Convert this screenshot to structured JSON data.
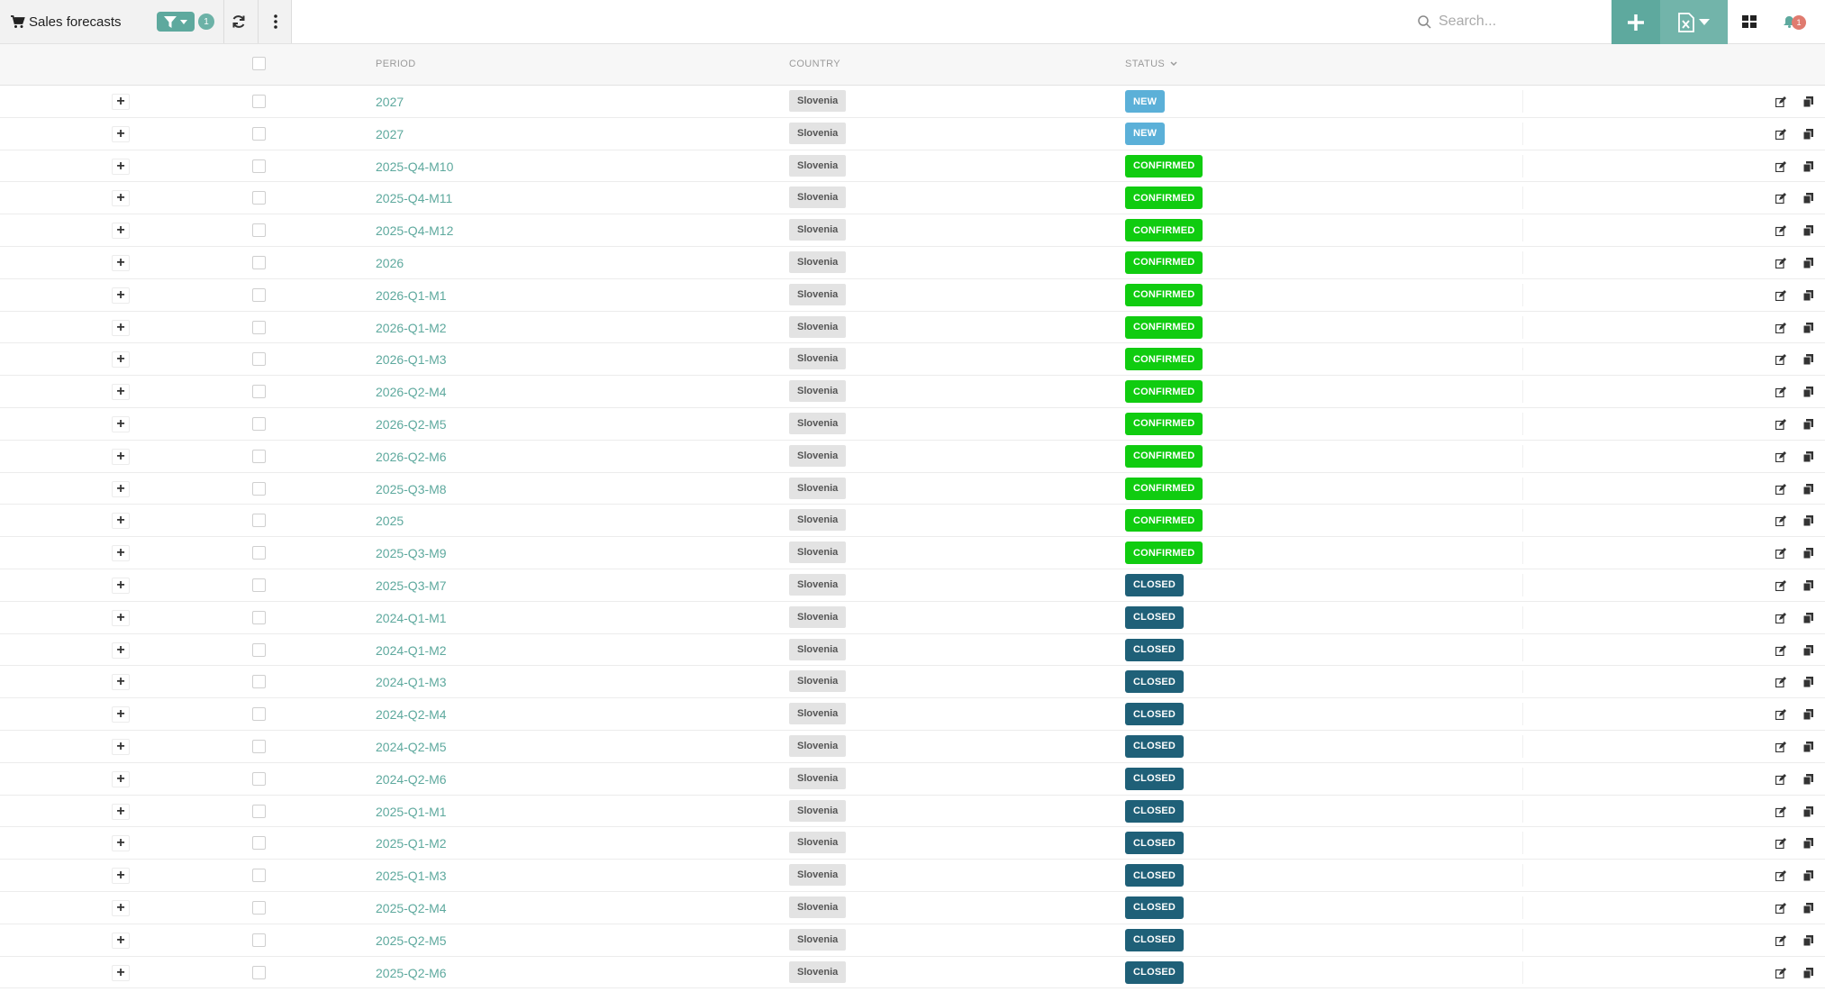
{
  "header": {
    "title": "Sales forecasts",
    "filter_count": "1",
    "search_placeholder": "Search...",
    "notification_count": "1"
  },
  "columns": {
    "period": "PERIOD",
    "country": "COUNTRY",
    "status": "STATUS"
  },
  "colors": {
    "accent": "#5ea99e",
    "status_new": "#5bb0d8",
    "status_confirmed": "#10cc10",
    "status_closed": "#1f6078"
  },
  "rows": [
    {
      "period": "2027",
      "country": "Slovenia",
      "status": "NEW",
      "kind": "new"
    },
    {
      "period": "2027",
      "country": "Slovenia",
      "status": "NEW",
      "kind": "new"
    },
    {
      "period": "2025-Q4-M10",
      "country": "Slovenia",
      "status": "CONFIRMED",
      "kind": "confirmed"
    },
    {
      "period": "2025-Q4-M11",
      "country": "Slovenia",
      "status": "CONFIRMED",
      "kind": "confirmed"
    },
    {
      "period": "2025-Q4-M12",
      "country": "Slovenia",
      "status": "CONFIRMED",
      "kind": "confirmed"
    },
    {
      "period": "2026",
      "country": "Slovenia",
      "status": "CONFIRMED",
      "kind": "confirmed"
    },
    {
      "period": "2026-Q1-M1",
      "country": "Slovenia",
      "status": "CONFIRMED",
      "kind": "confirmed"
    },
    {
      "period": "2026-Q1-M2",
      "country": "Slovenia",
      "status": "CONFIRMED",
      "kind": "confirmed"
    },
    {
      "period": "2026-Q1-M3",
      "country": "Slovenia",
      "status": "CONFIRMED",
      "kind": "confirmed"
    },
    {
      "period": "2026-Q2-M4",
      "country": "Slovenia",
      "status": "CONFIRMED",
      "kind": "confirmed"
    },
    {
      "period": "2026-Q2-M5",
      "country": "Slovenia",
      "status": "CONFIRMED",
      "kind": "confirmed"
    },
    {
      "period": "2026-Q2-M6",
      "country": "Slovenia",
      "status": "CONFIRMED",
      "kind": "confirmed"
    },
    {
      "period": "2025-Q3-M8",
      "country": "Slovenia",
      "status": "CONFIRMED",
      "kind": "confirmed"
    },
    {
      "period": "2025",
      "country": "Slovenia",
      "status": "CONFIRMED",
      "kind": "confirmed"
    },
    {
      "period": "2025-Q3-M9",
      "country": "Slovenia",
      "status": "CONFIRMED",
      "kind": "confirmed"
    },
    {
      "period": "2025-Q3-M7",
      "country": "Slovenia",
      "status": "CLOSED",
      "kind": "closed"
    },
    {
      "period": "2024-Q1-M1",
      "country": "Slovenia",
      "status": "CLOSED",
      "kind": "closed"
    },
    {
      "period": "2024-Q1-M2",
      "country": "Slovenia",
      "status": "CLOSED",
      "kind": "closed"
    },
    {
      "period": "2024-Q1-M3",
      "country": "Slovenia",
      "status": "CLOSED",
      "kind": "closed"
    },
    {
      "period": "2024-Q2-M4",
      "country": "Slovenia",
      "status": "CLOSED",
      "kind": "closed"
    },
    {
      "period": "2024-Q2-M5",
      "country": "Slovenia",
      "status": "CLOSED",
      "kind": "closed"
    },
    {
      "period": "2024-Q2-M6",
      "country": "Slovenia",
      "status": "CLOSED",
      "kind": "closed"
    },
    {
      "period": "2025-Q1-M1",
      "country": "Slovenia",
      "status": "CLOSED",
      "kind": "closed"
    },
    {
      "period": "2025-Q1-M2",
      "country": "Slovenia",
      "status": "CLOSED",
      "kind": "closed"
    },
    {
      "period": "2025-Q1-M3",
      "country": "Slovenia",
      "status": "CLOSED",
      "kind": "closed"
    },
    {
      "period": "2025-Q2-M4",
      "country": "Slovenia",
      "status": "CLOSED",
      "kind": "closed"
    },
    {
      "period": "2025-Q2-M5",
      "country": "Slovenia",
      "status": "CLOSED",
      "kind": "closed"
    },
    {
      "period": "2025-Q2-M6",
      "country": "Slovenia",
      "status": "CLOSED",
      "kind": "closed"
    }
  ]
}
